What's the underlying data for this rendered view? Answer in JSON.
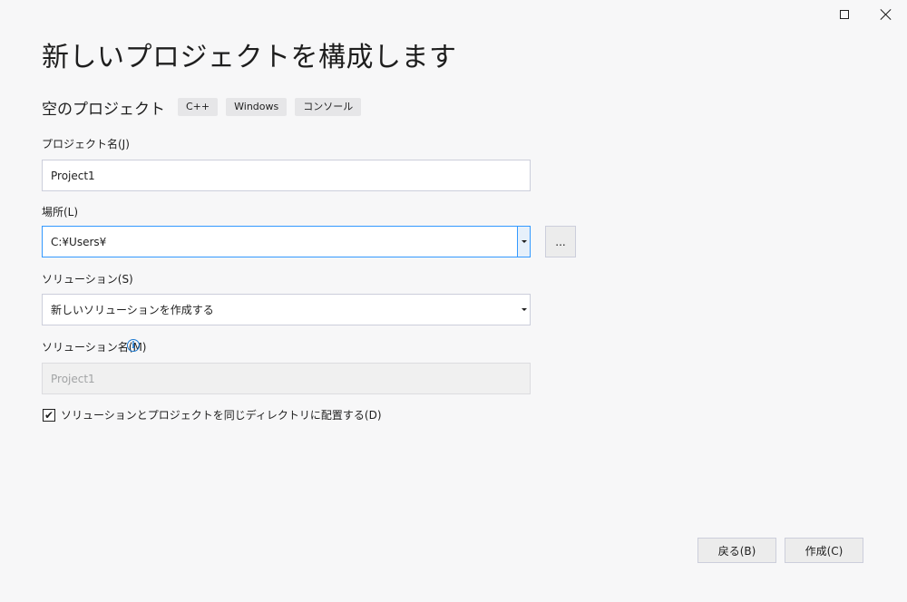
{
  "window": {
    "maximize_icon": "maximize-icon",
    "close_icon": "close-icon"
  },
  "page_title": "新しいプロジェクトを構成します",
  "template": {
    "name": "空のプロジェクト",
    "tags": [
      "C++",
      "Windows",
      "コンソール"
    ]
  },
  "form": {
    "project_name": {
      "label": "プロジェクト名(J)",
      "value": "Project1"
    },
    "location": {
      "label": "場所(L)",
      "value": "C:¥Users¥",
      "browse_label": "..."
    },
    "solution": {
      "label": "ソリューション(S)",
      "value": "新しいソリューションを作成する"
    },
    "solution_name": {
      "label": "ソリューション名(M)",
      "value": "Project1",
      "info_icon": "info-icon"
    },
    "same_directory": {
      "label": "ソリューションとプロジェクトを同じディレクトリに配置する(D)",
      "checked": true,
      "check_mark": "✔"
    }
  },
  "footer": {
    "back_label": "戻る(B)",
    "create_label": "作成(C)"
  }
}
